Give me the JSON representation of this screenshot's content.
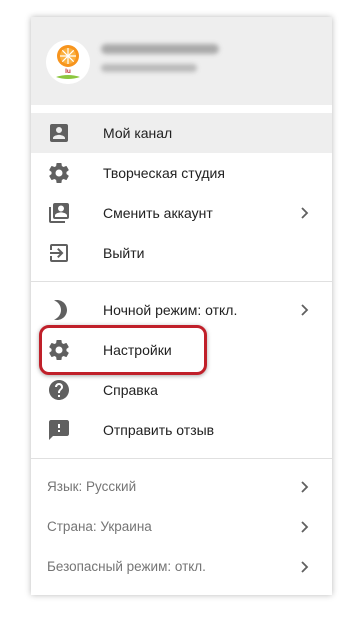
{
  "menu": {
    "main": [
      {
        "label": "Мой канал",
        "icon": "account-box-icon"
      },
      {
        "label": "Творческая студия",
        "icon": "gear-icon"
      },
      {
        "label": "Сменить аккаунт",
        "icon": "switch-account-icon"
      },
      {
        "label": "Выйти",
        "icon": "exit-icon"
      }
    ],
    "prefs": [
      {
        "label": "Ночной режим: откл.",
        "icon": "moon-icon"
      },
      {
        "label": "Настройки",
        "icon": "gear-icon"
      },
      {
        "label": "Справка",
        "icon": "help-icon"
      },
      {
        "label": "Отправить отзыв",
        "icon": "feedback-icon"
      }
    ],
    "footer": [
      {
        "label": "Язык: Русский"
      },
      {
        "label": "Страна: Украина"
      },
      {
        "label": "Безопасный режим: откл."
      }
    ]
  },
  "colors": {
    "icon": "#606060",
    "highlight": "#c0202a",
    "header_bg": "#eeeeee"
  }
}
